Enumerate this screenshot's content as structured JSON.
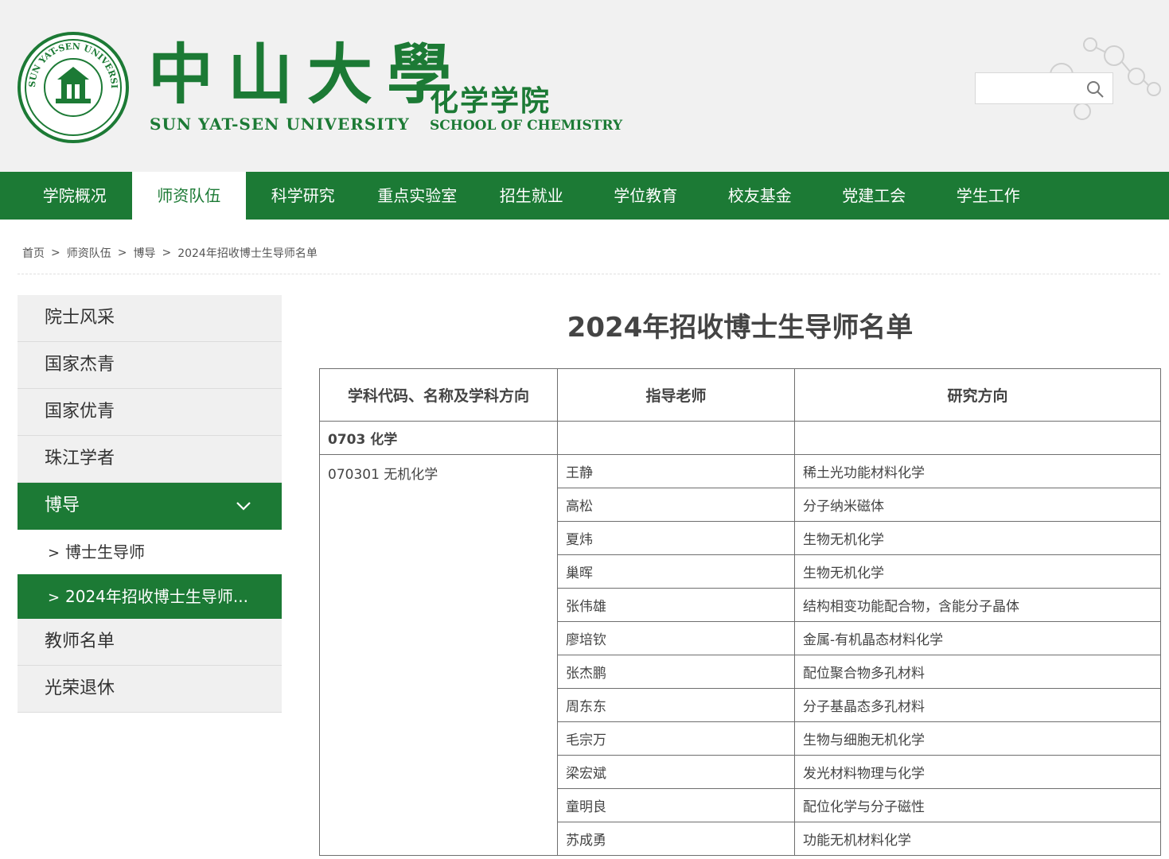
{
  "header": {
    "university_cn": "中山大學",
    "university_en": "SUN YAT-SEN UNIVERSITY",
    "school_cn": "化学学院",
    "school_en": "SCHOOL OF CHEMISTRY",
    "seal_text": "SUN YAT-SEN UNIVERSITY",
    "seal_text_cn": "中山大學",
    "search_placeholder": "",
    "brand_color": "#1c7a35"
  },
  "nav": {
    "items": [
      "学院概况",
      "师资队伍",
      "科学研究",
      "重点实验室",
      "招生就业",
      "学位教育",
      "校友基金",
      "党建工会",
      "学生工作"
    ],
    "active": "师资队伍"
  },
  "breadcrumb": [
    "首页",
    "师资队伍",
    "博导",
    "2024年招收博士生导师名单"
  ],
  "sidebar": {
    "items": [
      "院士风采",
      "国家杰青",
      "国家优青",
      "珠江学者",
      "博导",
      "教师名单",
      "光荣退休"
    ],
    "active": "博导",
    "sub_items": [
      "博士生导师",
      "2024年招收博士生导师..."
    ],
    "active_sub": "2024年招收博士生导师..."
  },
  "main": {
    "title": "2024年招收博士生导师名单",
    "table": {
      "headers": [
        "学科代码、名称及学科方向",
        "指导老师",
        "研究方向"
      ],
      "discipline": "0703 化学",
      "sub_discipline": "070301 无机化学",
      "rows": [
        {
          "advisor": "王静",
          "direction": "稀土光功能材料化学"
        },
        {
          "advisor": "高松",
          "direction": "分子纳米磁体"
        },
        {
          "advisor": "夏炜",
          "direction": "生物无机化学"
        },
        {
          "advisor": "巢晖",
          "direction": "生物无机化学"
        },
        {
          "advisor": "张伟雄",
          "direction": "结构相变功能配合物，含能分子晶体"
        },
        {
          "advisor": "廖培钦",
          "direction": "金属-有机晶态材料化学"
        },
        {
          "advisor": "张杰鹏",
          "direction": "配位聚合物多孔材料"
        },
        {
          "advisor": "周东东",
          "direction": "分子基晶态多孔材料"
        },
        {
          "advisor": "毛宗万",
          "direction": "生物与细胞无机化学"
        },
        {
          "advisor": "梁宏斌",
          "direction": "发光材料物理与化学"
        },
        {
          "advisor": "童明良",
          "direction": "配位化学与分子磁性"
        },
        {
          "advisor": "苏成勇",
          "direction": "功能无机材料化学"
        }
      ]
    }
  }
}
